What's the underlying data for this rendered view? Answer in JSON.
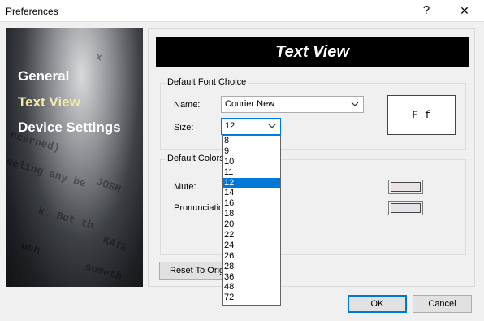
{
  "window": {
    "title": "Preferences",
    "help_glyph": "?",
    "close_glyph": "✕"
  },
  "sidebar": {
    "bg_lines": [
      "x",
      "ncerned)",
      "eeling any be",
      "JOSH",
      "k. But th",
      "uch.",
      "KATE",
      "someth"
    ],
    "items": [
      {
        "label": "General"
      },
      {
        "label": "Text View",
        "active": true
      },
      {
        "label": "Device Settings"
      }
    ]
  },
  "main": {
    "header": "Text View",
    "font_group": {
      "legend": "Default Font Choice",
      "name_label": "Name:",
      "name_value": "Courier New",
      "size_label": "Size:",
      "size_value": "12",
      "preview_text": "F f"
    },
    "colors_group": {
      "legend": "Default Colors",
      "mute_label": "Mute:",
      "pronunciation_label": "Pronunciation:",
      "mute_color": "#eae3e3",
      "pronunciation_color": "#e3e3ea"
    },
    "reset_button": "Reset To Original"
  },
  "size_options": [
    "8",
    "9",
    "10",
    "11",
    "12",
    "14",
    "16",
    "18",
    "20",
    "22",
    "24",
    "26",
    "28",
    "36",
    "48",
    "72"
  ],
  "selected_size": "12",
  "footer": {
    "ok": "OK",
    "cancel": "Cancel"
  },
  "colors": {
    "accent": "#0078d7",
    "active_nav": "#f3e9a9",
    "header_bg": "#000000"
  }
}
